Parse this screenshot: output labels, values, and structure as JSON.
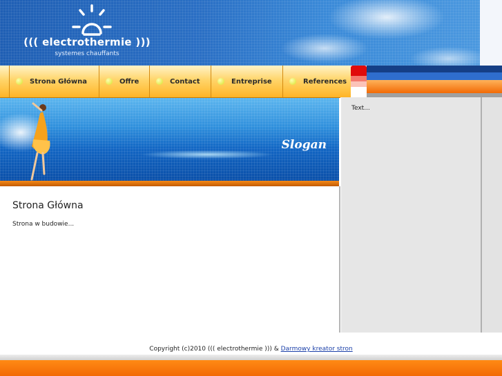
{
  "logo": {
    "title": "((( electrothermie )))",
    "subtitle": "systemes chauffants",
    "icon": "sun-icon"
  },
  "nav": {
    "items": [
      {
        "label": "Strona Główna"
      },
      {
        "label": "Offre"
      },
      {
        "label": "Contact"
      },
      {
        "label": "Entreprise"
      },
      {
        "label": "References"
      }
    ]
  },
  "banner": {
    "slogan": "Slogan"
  },
  "main": {
    "title": "Strona Główna",
    "text": "Strona w budowie..."
  },
  "sidebar": {
    "text": "Text..."
  },
  "footer": {
    "copyright": "Copyright (c)2010 ((( electrothermie ))) &",
    "link": "Darmowy kreator stron"
  },
  "colors": {
    "header_blue": "#2a6fc4",
    "nav_orange": "#ffb426",
    "footer_orange": "#f26a05",
    "link_blue": "#1a3fa8"
  }
}
